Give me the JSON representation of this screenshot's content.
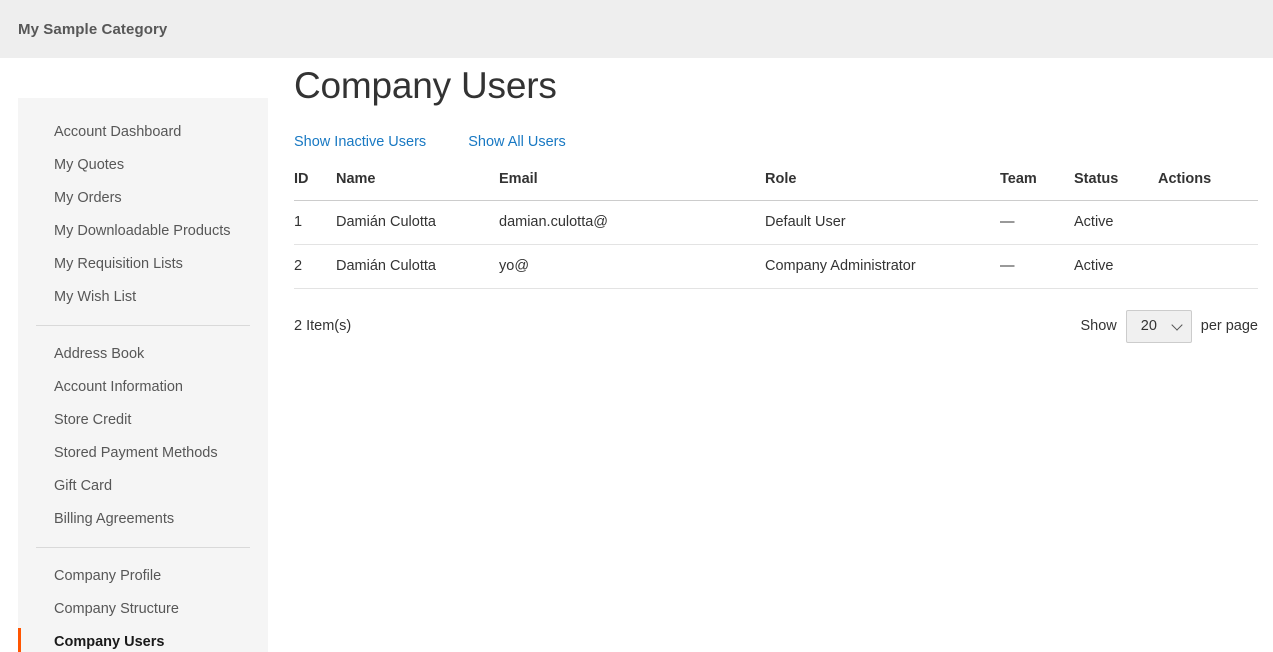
{
  "header": {
    "category_title": "My Sample Category"
  },
  "sidebar": {
    "groups": [
      {
        "items": [
          {
            "label": "Account Dashboard",
            "current": false
          },
          {
            "label": "My Quotes",
            "current": false
          },
          {
            "label": "My Orders",
            "current": false
          },
          {
            "label": "My Downloadable Products",
            "current": false
          },
          {
            "label": "My Requisition Lists",
            "current": false
          },
          {
            "label": "My Wish List",
            "current": false
          }
        ]
      },
      {
        "items": [
          {
            "label": "Address Book",
            "current": false
          },
          {
            "label": "Account Information",
            "current": false
          },
          {
            "label": "Store Credit",
            "current": false
          },
          {
            "label": "Stored Payment Methods",
            "current": false
          },
          {
            "label": "Gift Card",
            "current": false
          },
          {
            "label": "Billing Agreements",
            "current": false
          }
        ]
      },
      {
        "items": [
          {
            "label": "Company Profile",
            "current": false
          },
          {
            "label": "Company Structure",
            "current": false
          },
          {
            "label": "Company Users",
            "current": true
          }
        ]
      }
    ]
  },
  "main": {
    "page_title": "Company Users",
    "links": [
      {
        "label": "Show Inactive Users"
      },
      {
        "label": "Show All Users"
      }
    ],
    "table": {
      "columns": [
        "ID",
        "Name",
        "Email",
        "Role",
        "Team",
        "Status",
        "Actions"
      ],
      "rows": [
        {
          "id": "1",
          "name": "Damián Culotta",
          "email": "damian.culotta@",
          "role": "Default User",
          "team": "—",
          "status": "Active",
          "actions": ""
        },
        {
          "id": "2",
          "name": "Damián Culotta",
          "email": "yo@",
          "role": "Company Administrator",
          "team": "—",
          "status": "Active",
          "actions": ""
        }
      ]
    },
    "toolbar": {
      "amount": "2 Item(s)",
      "show_label": "Show",
      "per_page_value": "20",
      "per_page_label": "per page"
    }
  },
  "colors": {
    "accent_orange": "#ff5501",
    "link_blue": "#1979c3",
    "band_gray": "#eeeeee",
    "sidebar_gray": "#f5f5f5"
  }
}
